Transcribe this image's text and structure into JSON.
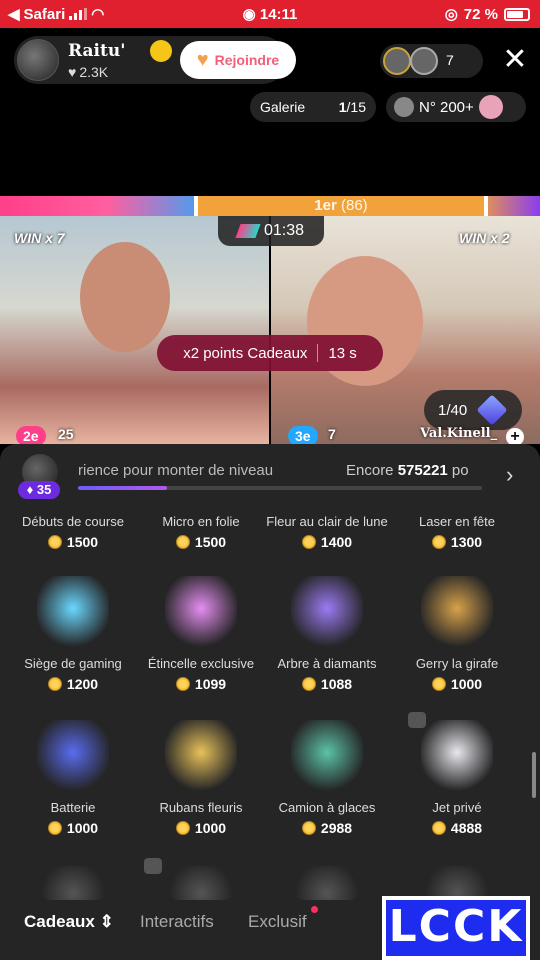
{
  "status": {
    "left_label": "Safari",
    "time": "14:11",
    "battery": "72 %"
  },
  "host": {
    "name": "Raitu'",
    "likes": "2.3K",
    "join_label": "Rejoindre"
  },
  "viewers": {
    "count": "7"
  },
  "gallery": {
    "label": "Galerie",
    "current": "1",
    "total": "/15"
  },
  "rank": {
    "label": "N° 200+"
  },
  "battle": {
    "position": "1er",
    "points": "(86)",
    "timer": "01:38",
    "left_win": "WIN x 7",
    "right_win": "WIN x 2"
  },
  "boost": {
    "label": "x2 points Cadeaux",
    "time": "13 s"
  },
  "left_player": {
    "position": "2e",
    "score": "25"
  },
  "right_player": {
    "position": "3e",
    "score": "7",
    "name": "Val.Kinell_"
  },
  "counter": {
    "value": "1/40"
  },
  "level": {
    "badge": "35",
    "text": "rience pour monter de niveau",
    "remaining_label": "Encore",
    "remaining_value": "575221",
    "remaining_suffix": " po",
    "progress": 0.22
  },
  "gifts": [
    {
      "name": "Débuts de course",
      "price": "1500",
      "color": "#3a3a3c"
    },
    {
      "name": "Micro en folie",
      "price": "1500",
      "color": "#3a3a3c"
    },
    {
      "name": "Fleur au clair de lune",
      "price": "1400",
      "color": "#3a3a3c"
    },
    {
      "name": "Laser en fête",
      "price": "1300",
      "color": "#3a3a3c"
    },
    {
      "name": "Siège de gaming",
      "price": "1200",
      "color": "#6ad8ff"
    },
    {
      "name": "Étincelle exclusive",
      "price": "1099",
      "color": "#e58ef0"
    },
    {
      "name": "Arbre à diamants",
      "price": "1088",
      "color": "#9b7bf3"
    },
    {
      "name": "Gerry la girafe",
      "price": "1000",
      "color": "#d8a24a"
    },
    {
      "name": "Batterie",
      "price": "1000",
      "color": "#5a6cf0"
    },
    {
      "name": "Rubans fleuris",
      "price": "1000",
      "color": "#e8c25a"
    },
    {
      "name": "Camion à glaces",
      "price": "2988",
      "color": "#5cc3a8"
    },
    {
      "name": "Jet privé",
      "price": "4888",
      "color": "#e8e8ee"
    }
  ],
  "tabs": {
    "gifts": "Cadeaux",
    "interactive": "Interactifs",
    "exclusive": "Exclusif"
  },
  "watermark": "LCCK"
}
